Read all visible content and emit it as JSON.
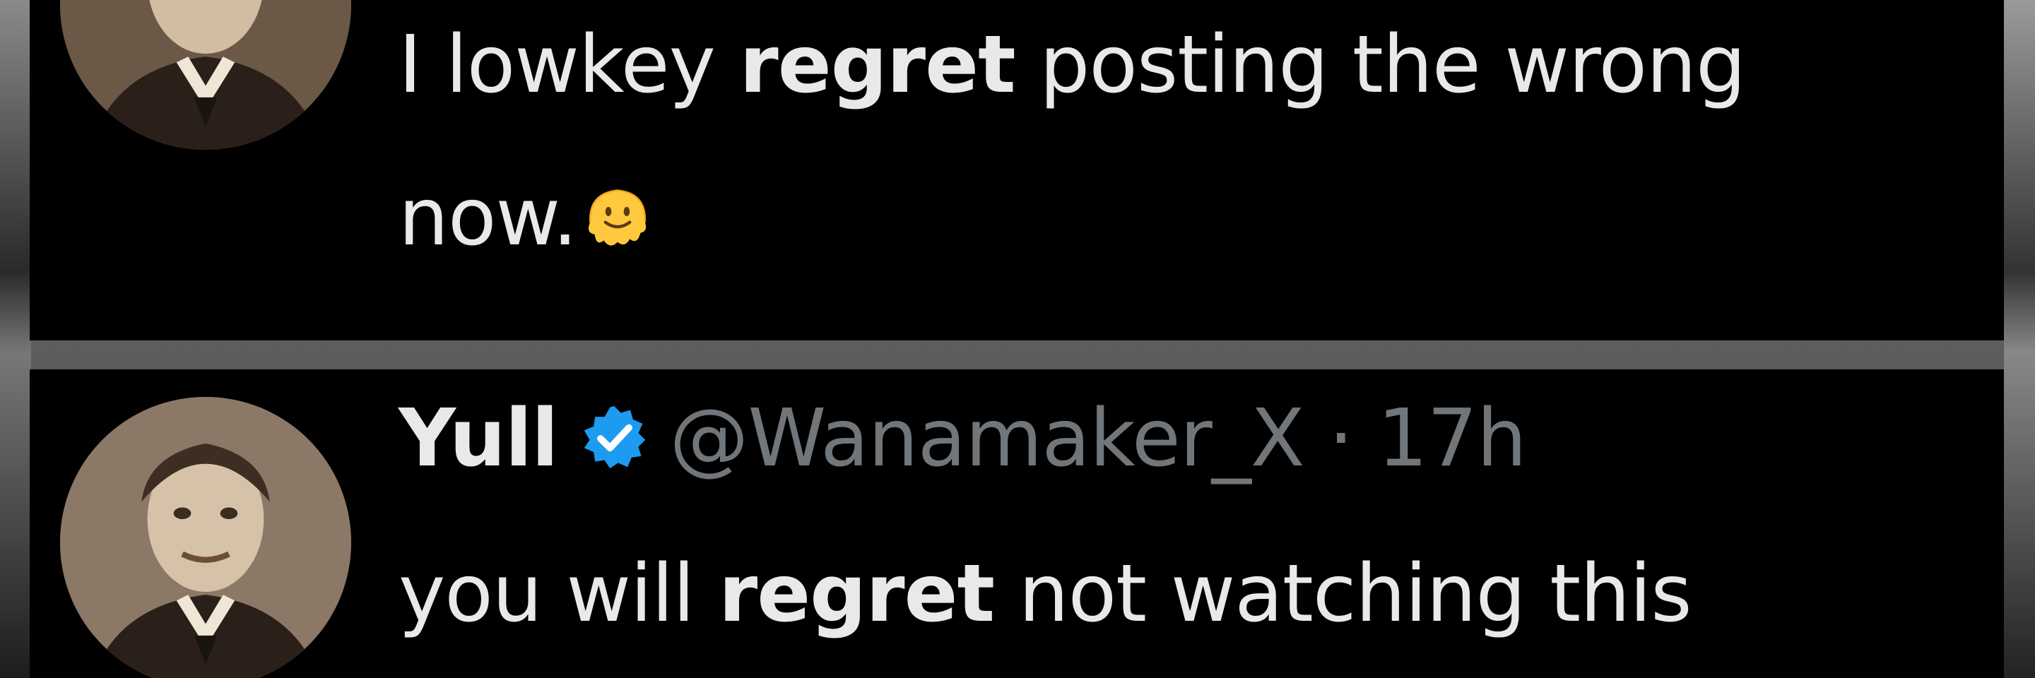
{
  "post_top": {
    "text_part1": "I lowkey ",
    "text_bold": "regret",
    "text_part2": " posting the wrong",
    "text_line2": "now.",
    "emoji_icon": "melting-face-emoji"
  },
  "post_bottom": {
    "display_name": "Yull",
    "verified_icon": "verified-badge-icon",
    "handle": "@Wanamaker_X",
    "separator": " · ",
    "time": "17h",
    "text_part1": "you will ",
    "text_bold": "regret",
    "text_part2": " not watching this"
  },
  "colors": {
    "background": "#000000",
    "text": "#e7e9ea",
    "secondary_text": "#71767b",
    "verified_blue": "#1d9bf0"
  }
}
